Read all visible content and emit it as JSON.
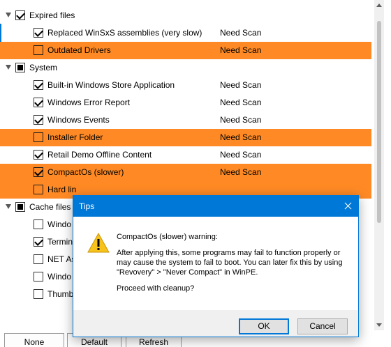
{
  "tree": {
    "rows": [
      {
        "label": "Expired files",
        "status": "",
        "state": "checked",
        "group": true,
        "highlight": false
      },
      {
        "label": "Replaced WinSxS assemblies (very slow)",
        "status": "Need Scan",
        "state": "checked",
        "group": false,
        "highlight": false
      },
      {
        "label": "Outdated Drivers",
        "status": "Need Scan",
        "state": "unchecked",
        "group": false,
        "highlight": true
      },
      {
        "label": "System",
        "status": "",
        "state": "partial",
        "group": true,
        "highlight": false
      },
      {
        "label": "Built-in Windows Store Application",
        "status": "Need Scan",
        "state": "checked",
        "group": false,
        "highlight": false
      },
      {
        "label": "Windows Error Report",
        "status": "Need Scan",
        "state": "checked",
        "group": false,
        "highlight": false
      },
      {
        "label": "Windows Events",
        "status": "Need Scan",
        "state": "checked",
        "group": false,
        "highlight": false
      },
      {
        "label": "Installer Folder",
        "status": "Need Scan",
        "state": "unchecked",
        "group": false,
        "highlight": true
      },
      {
        "label": "Retail Demo Offline Content",
        "status": "Need Scan",
        "state": "checked",
        "group": false,
        "highlight": false
      },
      {
        "label": "CompactOs (slower)",
        "status": "Need Scan",
        "state": "checked",
        "group": false,
        "highlight": true
      },
      {
        "label": "Hard lin",
        "status": "",
        "state": "unchecked",
        "group": false,
        "highlight": true
      },
      {
        "label": "Cache files",
        "status": "",
        "state": "partial",
        "group": true,
        "highlight": false
      },
      {
        "label": "Windo",
        "status": "",
        "state": "unchecked",
        "group": false,
        "highlight": false
      },
      {
        "label": "Termin",
        "status": "",
        "state": "checked",
        "group": false,
        "highlight": false
      },
      {
        "label": "NET As",
        "status": "",
        "state": "unchecked",
        "group": false,
        "highlight": false
      },
      {
        "label": "Windo",
        "status": "",
        "state": "unchecked",
        "group": false,
        "highlight": false
      },
      {
        "label": "Thumb",
        "status": "",
        "state": "unchecked",
        "group": false,
        "highlight": false
      }
    ]
  },
  "buttons": {
    "none": "None",
    "default": "Default",
    "refresh": "Refresh"
  },
  "dialog": {
    "title": "Tips",
    "icon": "warning-icon",
    "heading": "CompactOs (slower) warning:",
    "body": "After applying this, some programs may fail to function properly or may cause the system to fail to boot. You can later fix this by using \"Revovery\" > \"Never Compact\" in WinPE.",
    "question": "Proceed with cleanup?",
    "ok": "OK",
    "cancel": "Cancel"
  },
  "colors": {
    "highlight": "#ff8a25",
    "accent": "#0078d7",
    "warning": "#f7c21a"
  }
}
